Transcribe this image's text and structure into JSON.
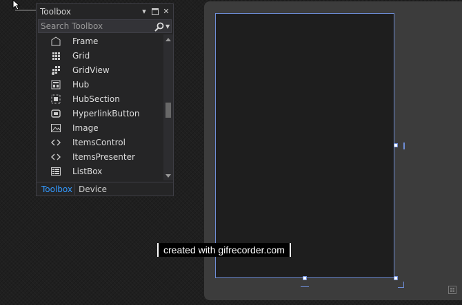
{
  "toolbox": {
    "title": "Toolbox",
    "search_placeholder": "Search Toolbox",
    "items": [
      {
        "label": "Frame",
        "icon": "frame-icon"
      },
      {
        "label": "Grid",
        "icon": "grid-icon"
      },
      {
        "label": "GridView",
        "icon": "gridview-icon"
      },
      {
        "label": "Hub",
        "icon": "hub-icon"
      },
      {
        "label": "HubSection",
        "icon": "hubsection-icon"
      },
      {
        "label": "HyperlinkButton",
        "icon": "hyperlinkbutton-icon"
      },
      {
        "label": "Image",
        "icon": "image-icon"
      },
      {
        "label": "ItemsControl",
        "icon": "code-brackets-icon"
      },
      {
        "label": "ItemsPresenter",
        "icon": "code-brackets-icon"
      },
      {
        "label": "ListBox",
        "icon": "listbox-icon"
      }
    ],
    "tabs": {
      "toolbox": "Toolbox",
      "device": "Device"
    },
    "active_tab_color": "#3399ff"
  },
  "designer": {
    "frame_border_color": "#6f8ed8"
  },
  "watermark": {
    "text": "created with gifrecorder.com"
  }
}
